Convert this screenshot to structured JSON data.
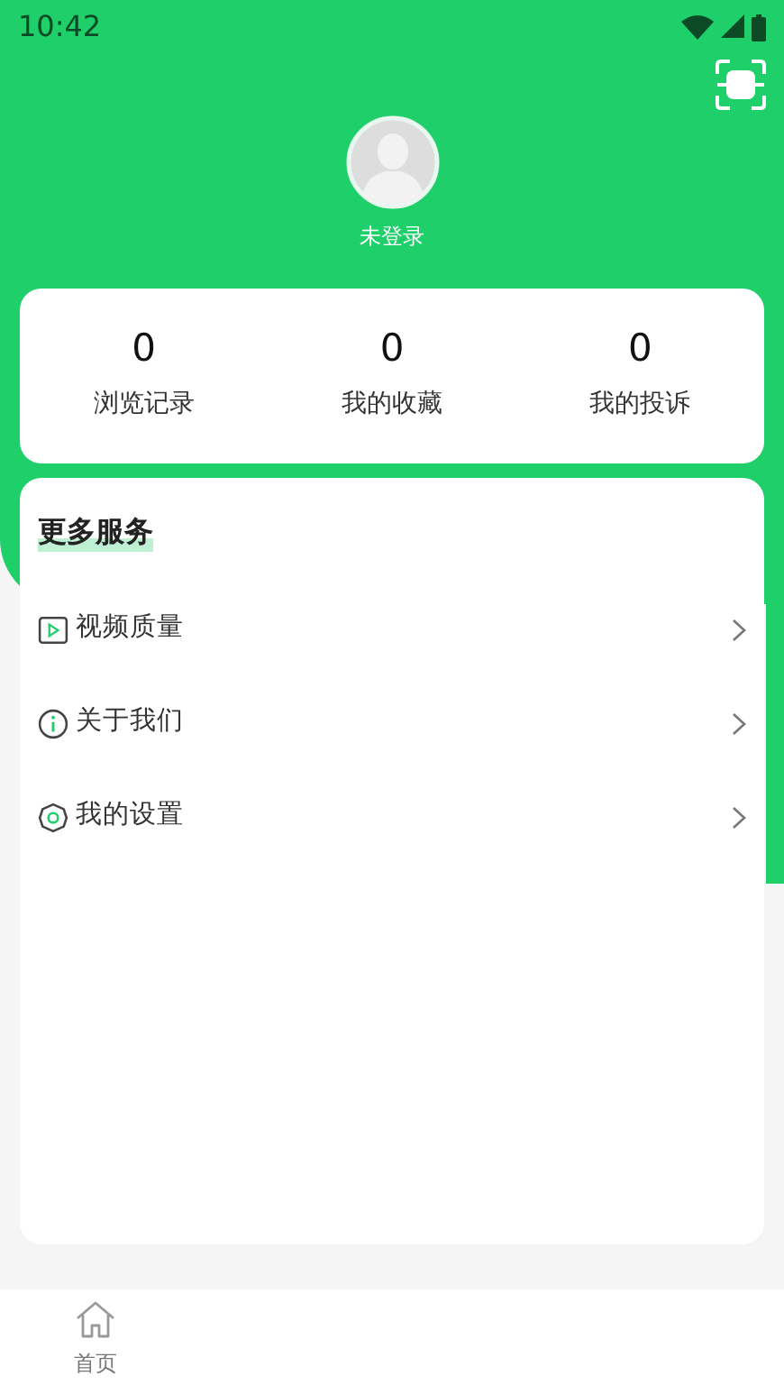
{
  "status_bar": {
    "time": "10:42"
  },
  "profile": {
    "name": "未登录"
  },
  "stats": [
    {
      "value": "0",
      "label": "浏览记录"
    },
    {
      "value": "0",
      "label": "我的收藏"
    },
    {
      "value": "0",
      "label": "我的投诉"
    }
  ],
  "services": {
    "title": "更多服务",
    "items": [
      {
        "kind": "video",
        "label": "视频质量"
      },
      {
        "kind": "info",
        "label": "关于我们"
      },
      {
        "kind": "settings",
        "label": "我的设置"
      }
    ]
  },
  "tab_bar": [
    {
      "label": "首页",
      "selected": false
    }
  ]
}
